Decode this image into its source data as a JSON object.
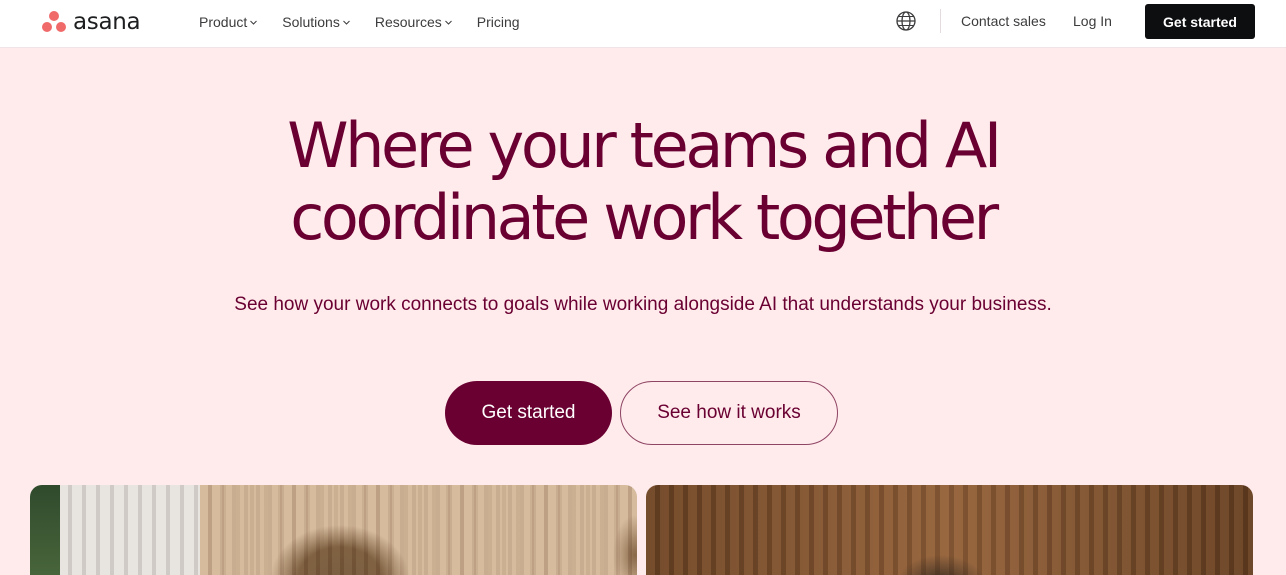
{
  "brand": {
    "name": "asana",
    "logo_color": "#f06a6a"
  },
  "nav": {
    "items": [
      {
        "label": "Product",
        "has_dropdown": true
      },
      {
        "label": "Solutions",
        "has_dropdown": true
      },
      {
        "label": "Resources",
        "has_dropdown": true
      },
      {
        "label": "Pricing",
        "has_dropdown": false
      }
    ],
    "language_icon": "globe-icon",
    "contact_label": "Contact sales",
    "login_label": "Log In",
    "cta_label": "Get started"
  },
  "hero": {
    "title_line1": "Where your teams and AI",
    "title_line2": "coordinate work together",
    "subtitle": "See how your work connects to goals while working alongside AI that understands your business.",
    "primary_cta": "Get started",
    "secondary_cta": "See how it works"
  },
  "colors": {
    "hero_bg": "#ffeaec",
    "accent": "#690031",
    "header_cta_bg": "#0d0e10"
  },
  "images": [
    {
      "name": "hero-photo-left",
      "desc_icon": "photo"
    },
    {
      "name": "hero-photo-right",
      "desc_icon": "photo"
    }
  ]
}
